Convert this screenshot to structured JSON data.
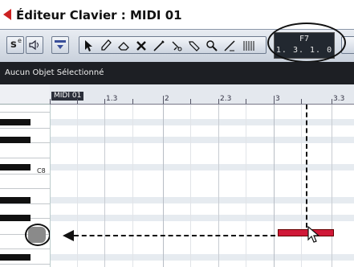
{
  "window": {
    "title": "Éditeur Clavier : MIDI 01"
  },
  "toolbar": {
    "solo_label": "s",
    "solo_sup": "e",
    "tools": [
      "arrow-tool-icon",
      "pencil-tool-icon",
      "eraser-tool-icon",
      "mute-tool-icon",
      "draw-tool-icon",
      "split-tool-icon",
      "line-tool-icon",
      "zoom-tool-icon",
      "line-shape-tool-icon",
      "quantize-grid-icon"
    ],
    "display": {
      "pitch": "F7",
      "position": "1. 3. 1.   0"
    }
  },
  "infoline": {
    "text": "Aucun Objet Sélectionné"
  },
  "ruler": {
    "part_label": "MIDI 01",
    "marks": [
      "1.3",
      "2",
      "2.3",
      "3",
      "3.3"
    ]
  },
  "keyboard": {
    "c_label": "C8"
  },
  "colors": {
    "note": "#d01838",
    "infoline_bg": "#1d1f24",
    "title_arrow": "#cc2222"
  }
}
